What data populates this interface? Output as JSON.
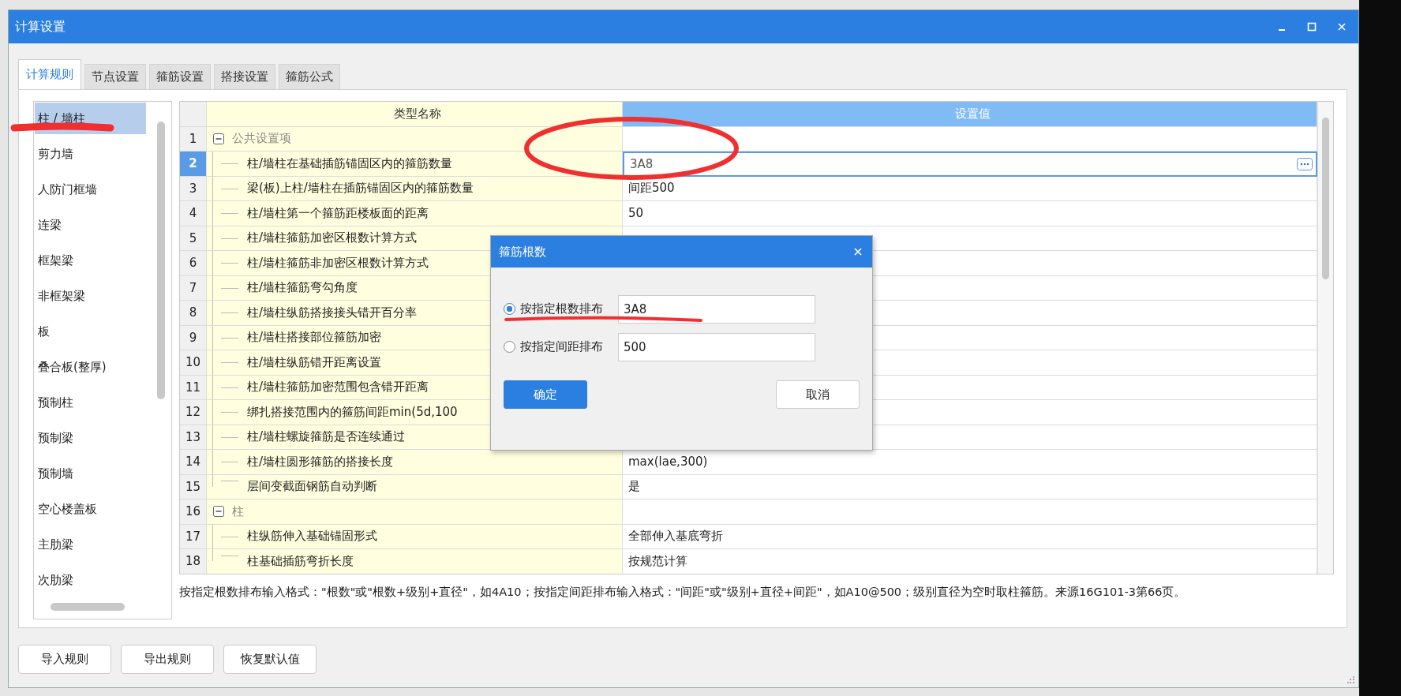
{
  "window": {
    "title": "计算设置"
  },
  "tabs": [
    {
      "label": "计算规则",
      "selected": true
    },
    {
      "label": "节点设置",
      "selected": false
    },
    {
      "label": "箍筋设置",
      "selected": false
    },
    {
      "label": "搭接设置",
      "selected": false
    },
    {
      "label": "箍筋公式",
      "selected": false
    }
  ],
  "categories": [
    {
      "label": "柱 / 墙柱",
      "selected": true
    },
    {
      "label": "剪力墙",
      "selected": false
    },
    {
      "label": "人防门框墙",
      "selected": false
    },
    {
      "label": "连梁",
      "selected": false
    },
    {
      "label": "框架梁",
      "selected": false
    },
    {
      "label": "非框架梁",
      "selected": false
    },
    {
      "label": "板",
      "selected": false
    },
    {
      "label": "叠合板(整厚)",
      "selected": false
    },
    {
      "label": "预制柱",
      "selected": false
    },
    {
      "label": "预制梁",
      "selected": false
    },
    {
      "label": "预制墙",
      "selected": false
    },
    {
      "label": "空心楼盖板",
      "selected": false
    },
    {
      "label": "主肋梁",
      "selected": false
    },
    {
      "label": "次肋梁",
      "selected": false
    }
  ],
  "table": {
    "columns": [
      "类型名称",
      "设置值"
    ],
    "rows": [
      {
        "number": "1",
        "name": "公共设置项",
        "expanded": true,
        "children": [
          {
            "number": "2",
            "name": "柱/墙柱在基础插筋锚固区内的箍筋数量",
            "value": "3A8",
            "selected": true
          },
          {
            "number": "3",
            "name": "梁(板)上柱/墙柱在插筋锚固区内的箍筋数量",
            "value": "间距500",
            "selected": false
          },
          {
            "number": "4",
            "name": "柱/墙柱第一个箍筋距楼板面的距离",
            "value": "50",
            "selected": false
          },
          {
            "number": "5",
            "name": "柱/墙柱箍筋加密区根数计算方式",
            "selected": false
          },
          {
            "number": "6",
            "name": "柱/墙柱箍筋非加密区根数计算方式",
            "selected": false
          },
          {
            "number": "7",
            "name": "柱/墙柱箍筋弯勾角度",
            "selected": false
          },
          {
            "number": "8",
            "name": "柱/墙柱纵筋搭接接头错开百分率",
            "selected": false
          },
          {
            "number": "9",
            "name": "柱/墙柱搭接部位箍筋加密",
            "selected": false
          },
          {
            "number": "10",
            "name": "柱/墙柱纵筋错开距离设置",
            "selected": false
          },
          {
            "number": "11",
            "name": "柱/墙柱箍筋加密范围包含错开距离",
            "selected": false
          },
          {
            "number": "12",
            "name": "绑扎搭接范围内的箍筋间距min(5d,100",
            "selected": false
          },
          {
            "number": "13",
            "name": "柱/墙柱螺旋箍筋是否连续通过",
            "selected": false
          },
          {
            "number": "14",
            "name": "柱/墙柱圆形箍筋的搭接长度",
            "value": "max(lae,300)",
            "selected": false
          },
          {
            "number": "15",
            "name": "层间变截面钢筋自动判断",
            "value": "是",
            "selected": false
          }
        ]
      },
      {
        "number": "16",
        "name": "柱",
        "expanded": true,
        "children": [
          {
            "number": "17",
            "name": "柱纵筋伸入基础锚固形式",
            "value": "全部伸入基底弯折",
            "selected": false
          },
          {
            "number": "18",
            "name": "柱基础插筋弯折长度",
            "value": "按规范计算",
            "selected": false
          }
        ]
      }
    ]
  },
  "description": "按指定根数排布输入格式：\"根数\"或\"根数+级别+直径\"，如4A10；按指定间距排布输入格式：\"间距\"或\"级别+直径+间距\"，如A10@500；级别直径为空时取柱箍筋。来源16G101-3第66页。",
  "buttons": [
    "导入规则",
    "导出规则",
    "恢复默认值"
  ],
  "dialog": {
    "title": "箍筋根数",
    "options": [
      {
        "label": "按指定根数排布",
        "value": "3A8",
        "selected": true
      },
      {
        "label": "按指定间距排布",
        "value": "500",
        "selected": false
      }
    ],
    "buttons": [
      {
        "label": "确定",
        "kind": "primary"
      },
      {
        "label": "取消",
        "kind": "secondary"
      }
    ]
  }
}
